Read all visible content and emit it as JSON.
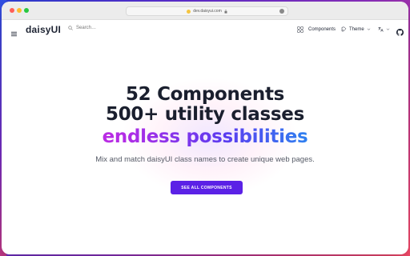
{
  "browser": {
    "url": "dev.daisyui.com"
  },
  "navbar": {
    "logo": "daisyUI",
    "search_placeholder": "Search…",
    "components_label": "Components",
    "theme_label": "Theme"
  },
  "hero": {
    "line1": "52 Components",
    "line2": "500+ utility classes",
    "line3": "endless possibilities",
    "subtitle": "Mix and match daisyUI class names to create unique web pages.",
    "cta_label": "SEE ALL COMPONENTS"
  },
  "icons": {
    "menu": "menu-icon",
    "search": "search-icon",
    "components": "components-icon",
    "theme": "theme-icon",
    "language": "language-icon",
    "github": "github-icon"
  },
  "colors": {
    "cta_background": "#5b21e6",
    "gradient_start": "#d92ad7",
    "gradient_end": "#2ec6e6"
  }
}
